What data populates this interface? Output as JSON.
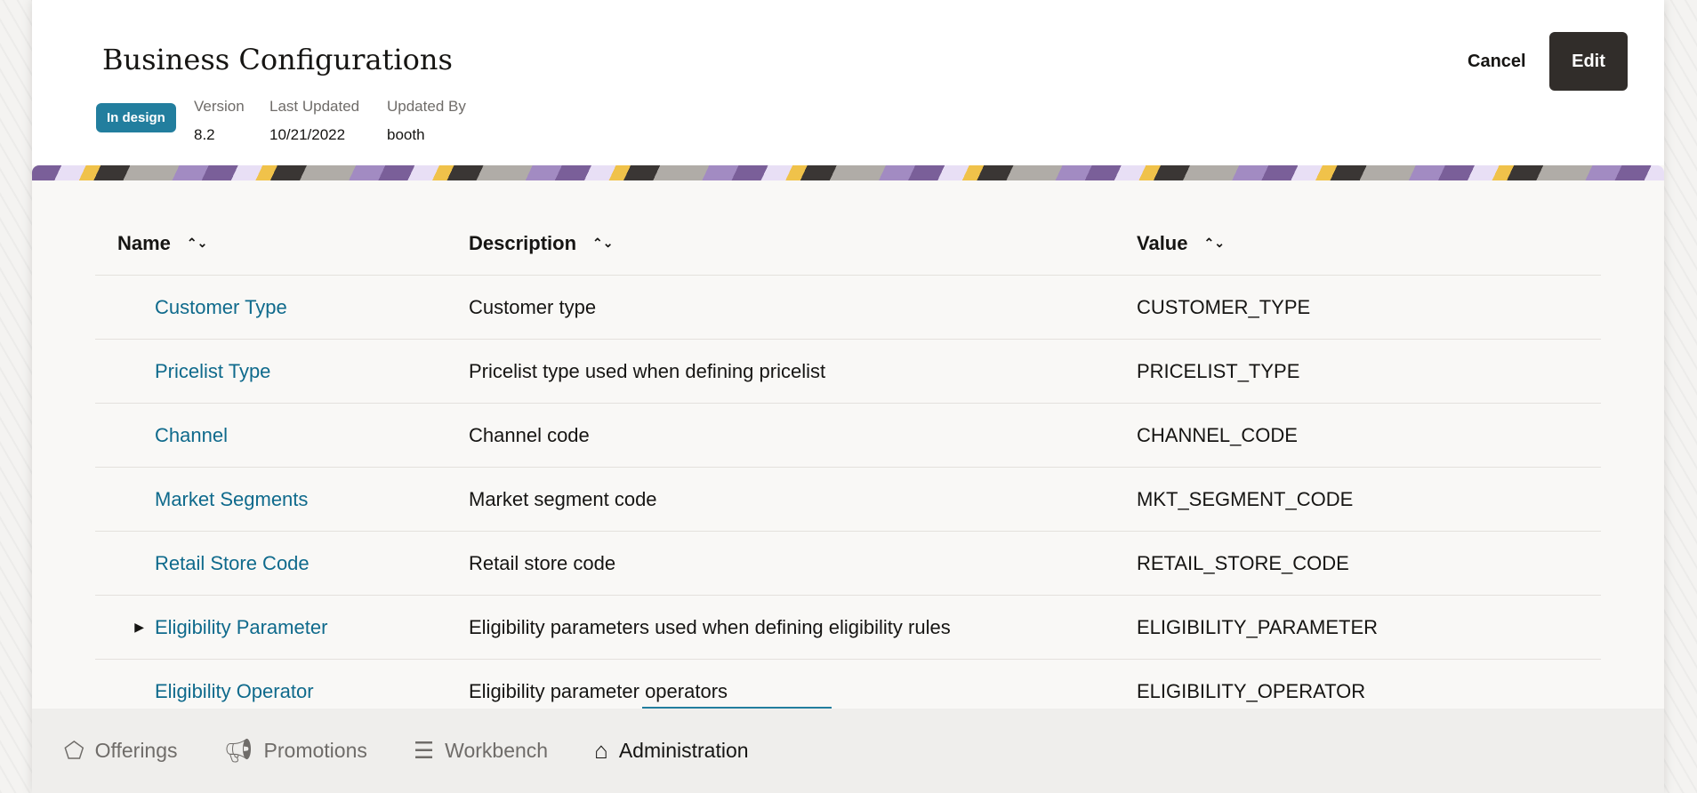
{
  "header": {
    "title": "Business Configurations",
    "status": "In design",
    "version_label": "Version",
    "version": "8.2",
    "last_updated_label": "Last Updated",
    "last_updated": "10/21/2022",
    "updated_by_label": "Updated By",
    "updated_by": "booth",
    "cancel": "Cancel",
    "edit": "Edit"
  },
  "table": {
    "columns": [
      "Name",
      "Description",
      "Value"
    ],
    "rows": [
      {
        "name": "Customer Type",
        "description": "Customer type",
        "value": "CUSTOMER_TYPE"
      },
      {
        "name": "Pricelist Type",
        "description": "Pricelist type used when defining pricelist",
        "value": "PRICELIST_TYPE"
      },
      {
        "name": "Channel",
        "description": "Channel code",
        "value": "CHANNEL_CODE"
      },
      {
        "name": "Market Segments",
        "description": "Market segment code",
        "value": "MKT_SEGMENT_CODE"
      },
      {
        "name": "Retail Store Code",
        "description": "Retail store code",
        "value": "RETAIL_STORE_CODE"
      },
      {
        "name": "Eligibility Parameter",
        "description": "Eligibility parameters used when defining eligibility rules",
        "value": "ELIGIBILITY_PARAMETER"
      },
      {
        "name": "Eligibility Operator",
        "description": "Eligibility parameter operators",
        "value": "ELIGIBILITY_OPERATOR"
      }
    ]
  },
  "nav": [
    {
      "label": "Offerings",
      "icon": "tag-icon"
    },
    {
      "label": "Promotions",
      "icon": "megaphone-icon"
    },
    {
      "label": "Workbench",
      "icon": "list-icon"
    },
    {
      "label": "Administration",
      "icon": "admin-icon"
    }
  ],
  "colors": {
    "accent": "#227e9e",
    "link": "#0f6a8c"
  }
}
